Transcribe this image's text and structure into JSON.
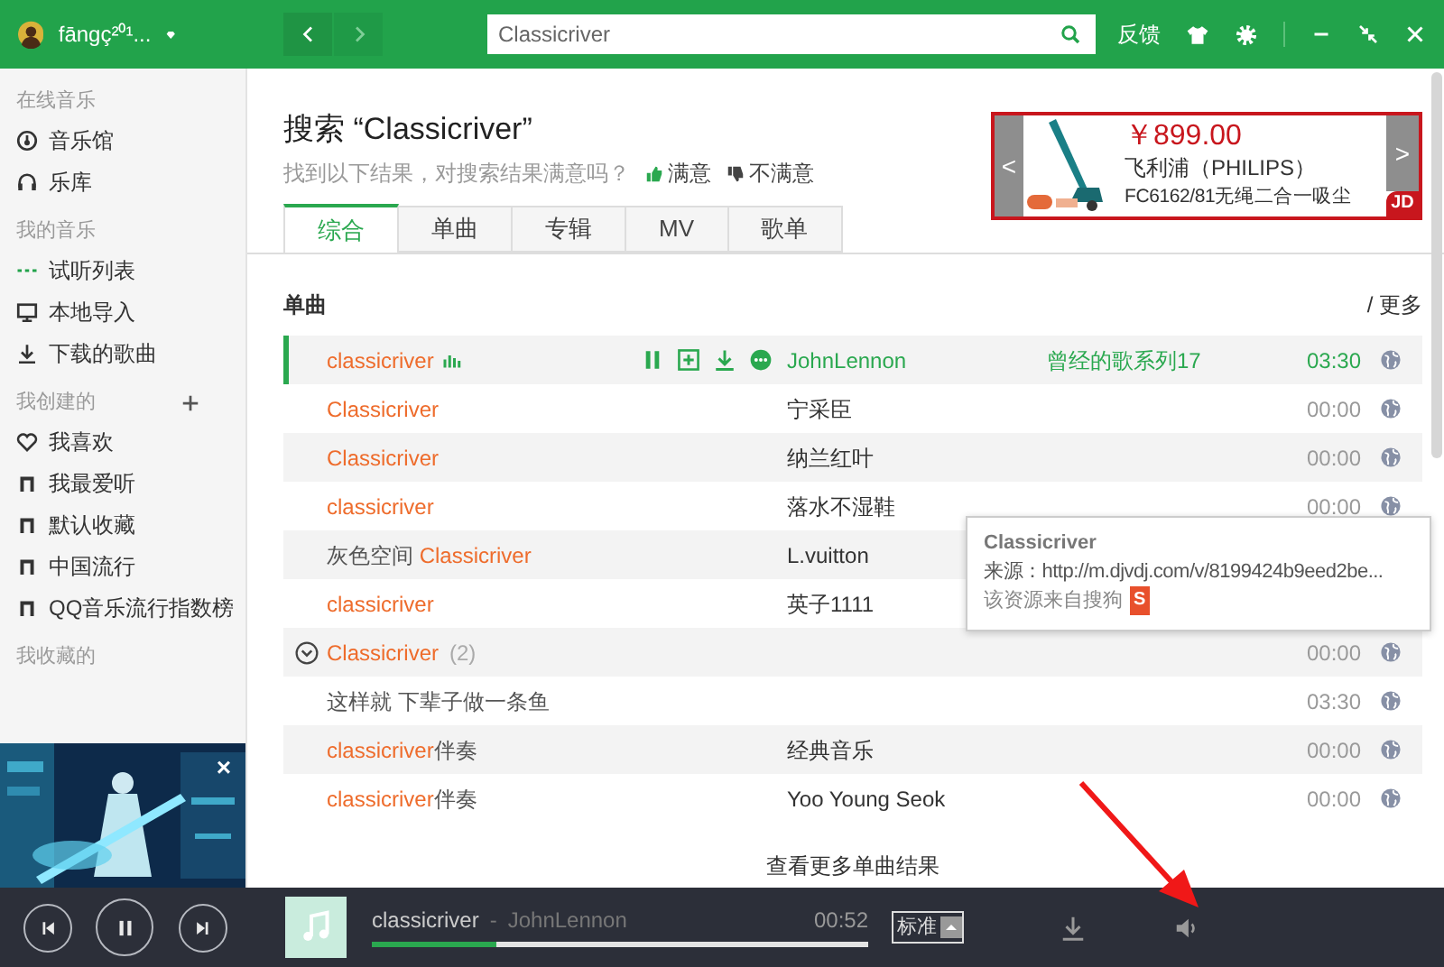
{
  "top_bar": {
    "username": "fāngç²⁰¹...",
    "nav": [
      {
        "kind": "back",
        "disabled": false
      },
      {
        "kind": "forward",
        "disabled": true
      }
    ],
    "search": {
      "value": "Classicriver"
    },
    "feedback": "反馈"
  },
  "sidebar": {
    "sections": [
      {
        "title": "在线音乐",
        "can_add": false,
        "items": [
          {
            "kind": "radio",
            "label": "音乐馆"
          },
          {
            "kind": "headphones",
            "label": "乐库"
          }
        ]
      },
      {
        "title": "我的音乐",
        "can_add": false,
        "items": [
          {
            "kind": "queue",
            "label": "试听列表"
          },
          {
            "kind": "monitor",
            "label": "本地导入"
          },
          {
            "kind": "download",
            "label": "下载的歌曲"
          }
        ]
      },
      {
        "title": "我创建的",
        "can_add": true,
        "items": [
          {
            "kind": "heart",
            "label": "我喜欢"
          },
          {
            "kind": "note",
            "label": "我最爱听"
          },
          {
            "kind": "note",
            "label": "默认收藏"
          },
          {
            "kind": "note",
            "label": "中国流行"
          },
          {
            "kind": "note",
            "label": "QQ音乐流行指数榜"
          }
        ]
      },
      {
        "title": "我收藏的",
        "can_add": false
      }
    ],
    "ad": {
      "kind": "picture",
      "close": "×"
    }
  },
  "search": {
    "title": "搜索 “Classicriver”",
    "prompt": "找到以下结果，对搜索结果满意吗？",
    "feedback": [
      {
        "kind": "like",
        "label": "满意"
      },
      {
        "kind": "dislike",
        "label": "不满意"
      }
    ],
    "tabs": [
      {
        "label": "综合",
        "selected": true
      },
      {
        "label": "单曲",
        "selected": false
      },
      {
        "label": "专辑",
        "selected": false
      },
      {
        "label": "MV",
        "selected": false
      },
      {
        "label": "歌单",
        "selected": false
      }
    ]
  },
  "ad": {
    "prev": "<",
    "next": ">",
    "price": "￥899.00",
    "brand": "飞利浦（PHILIPS）",
    "model": "FC6162/81无绳二合一吸尘",
    "badge": "JD"
  },
  "songs": {
    "heading": "单曲",
    "more": "/ 更多",
    "see_more": "查看更多单曲结果",
    "rows": [
      {
        "kind": "song",
        "playing": true,
        "title_parts": [
          {
            "text": "classicriver",
            "match": true
          }
        ],
        "artist": "JohnLennon",
        "album": "曾经的歌系列17",
        "duration": "03:30"
      },
      {
        "kind": "song",
        "playing": false,
        "title_parts": [
          {
            "text": "Classicriver",
            "match": true
          }
        ],
        "artist": "宁采臣",
        "duration": "00:00"
      },
      {
        "kind": "song",
        "playing": false,
        "title_parts": [
          {
            "text": "Classicriver",
            "match": true
          }
        ],
        "artist": "纳兰红叶",
        "duration": "00:00"
      },
      {
        "kind": "song",
        "playing": false,
        "title_parts": [
          {
            "text": "classicriver",
            "match": true
          }
        ],
        "artist": "落水不湿鞋",
        "duration": "00:00"
      },
      {
        "kind": "song",
        "playing": false,
        "title_parts": [
          {
            "text": "灰色空间 ",
            "match": false
          },
          {
            "text": "Classicriver",
            "match": true
          }
        ],
        "artist": "L.vuitton"
      },
      {
        "kind": "song",
        "playing": false,
        "title_parts": [
          {
            "text": "classicriver",
            "match": true
          }
        ],
        "artist": "英子1111"
      },
      {
        "kind": "group",
        "playing": false,
        "expanded": false,
        "title_parts": [
          {
            "text": "Classicriver",
            "match": true
          }
        ],
        "count": "(2)",
        "duration": "00:00"
      },
      {
        "kind": "song",
        "playing": false,
        "title_parts": [
          {
            "text": "这样就 下辈子做一条鱼",
            "match": false
          }
        ],
        "duration": "03:30"
      },
      {
        "kind": "song",
        "playing": false,
        "title_parts": [
          {
            "text": "classicriver",
            "match": true
          },
          {
            "text": "伴奏",
            "match": false
          }
        ],
        "artist": "经典音乐",
        "duration": "00:00"
      },
      {
        "kind": "song",
        "playing": false,
        "title_parts": [
          {
            "text": "classicriver",
            "match": true
          },
          {
            "text": "伴奏",
            "match": false
          }
        ],
        "artist": "Yoo Young Seok",
        "duration": "00:00"
      }
    ]
  },
  "tooltip": {
    "title": "Classicriver",
    "source": "来源：http://m.djvdj.com/v/8199424b9eed2be...",
    "note": "该资源来自搜狗",
    "logo": "S"
  },
  "player": {
    "title": "classicriver",
    "separator": "-",
    "artist": "JohnLennon",
    "time": "00:52",
    "level": 0.25,
    "quality": "标准"
  }
}
